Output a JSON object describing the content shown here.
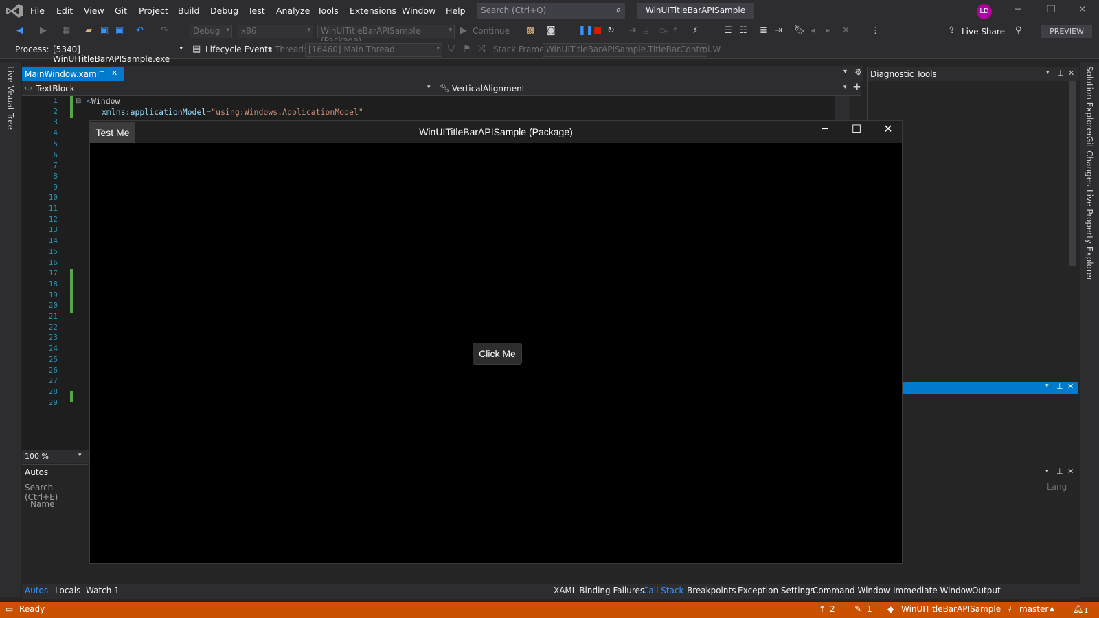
{
  "menubar": {
    "items": [
      "File",
      "Edit",
      "View",
      "Git",
      "Project",
      "Build",
      "Debug",
      "Test",
      "Analyze",
      "Tools",
      "Extensions",
      "Window",
      "Help"
    ],
    "search_placeholder": "Search (Ctrl+Q)",
    "solution_title": "WinUITitleBarAPISample",
    "avatar_initials": "LD"
  },
  "toolbar": {
    "configuration": "Debug",
    "platform": "x86",
    "startup_project": "WinUITitleBarAPISample (Package)",
    "continue_label": "Continue",
    "live_share_label": "Live Share",
    "preview_label": "PREVIEW"
  },
  "debug_location": {
    "process_label": "Process:",
    "process_value": "[5340] WinUITitleBarAPISample.exe",
    "lifecycle_label": "Lifecycle Events",
    "thread_label": "Thread:",
    "thread_value": "[16460] Main Thread",
    "stack_frame_label": "Stack Frame:",
    "stack_frame_value": "WinUITitleBarAPISample.TitleBarControl.W"
  },
  "left_strip": {
    "tab": "Live Visual Tree"
  },
  "right_strip": {
    "tabs": [
      "Solution Explorer",
      "Git Changes",
      "Live Property Explorer"
    ]
  },
  "editor": {
    "tab_label": "MainWindow.xaml",
    "nav_left": "TextBlock",
    "nav_right": "VerticalAlignment",
    "line_numbers": [
      "1",
      "2",
      "3",
      "4",
      "5",
      "6",
      "7",
      "8",
      "9",
      "10",
      "11",
      "12",
      "13",
      "14",
      "15",
      "16",
      "17",
      "18",
      "19",
      "20",
      "21",
      "22",
      "23",
      "24",
      "25",
      "26",
      "27",
      "28",
      "29"
    ],
    "code_line1": "Window",
    "code_line2_attr": "xmlns:applicationModel=",
    "code_line2_val": "\"using:Windows.ApplicationModel\"",
    "zoom": "100 %"
  },
  "autos": {
    "title": "Autos",
    "search_placeholder": "Search (Ctrl+E)",
    "column_name": "Name"
  },
  "bottom_tabs_left": [
    "Autos",
    "Locals",
    "Watch 1"
  ],
  "bottom_tabs_right": [
    "XAML Binding Failures",
    "Call Stack",
    "Breakpoints",
    "Exception Settings",
    "Command Window",
    "Immediate Window",
    "Output"
  ],
  "diagnostic": {
    "title": "Diagnostic Tools"
  },
  "lower_right": {
    "column_lang": "Lang"
  },
  "status_bar": {
    "ready": "Ready",
    "push_count": "2",
    "pending_count": "1",
    "repo": "WinUITitleBarAPISample",
    "branch": "master",
    "notifications": "1"
  },
  "app_window": {
    "title": "WinUITitleBarAPISample (Package)",
    "test_button": "Test Me",
    "click_button": "Click Me"
  },
  "colors": {
    "accent": "#007acc",
    "status_bar": "#ca5100",
    "avatar": "#b4009e"
  }
}
